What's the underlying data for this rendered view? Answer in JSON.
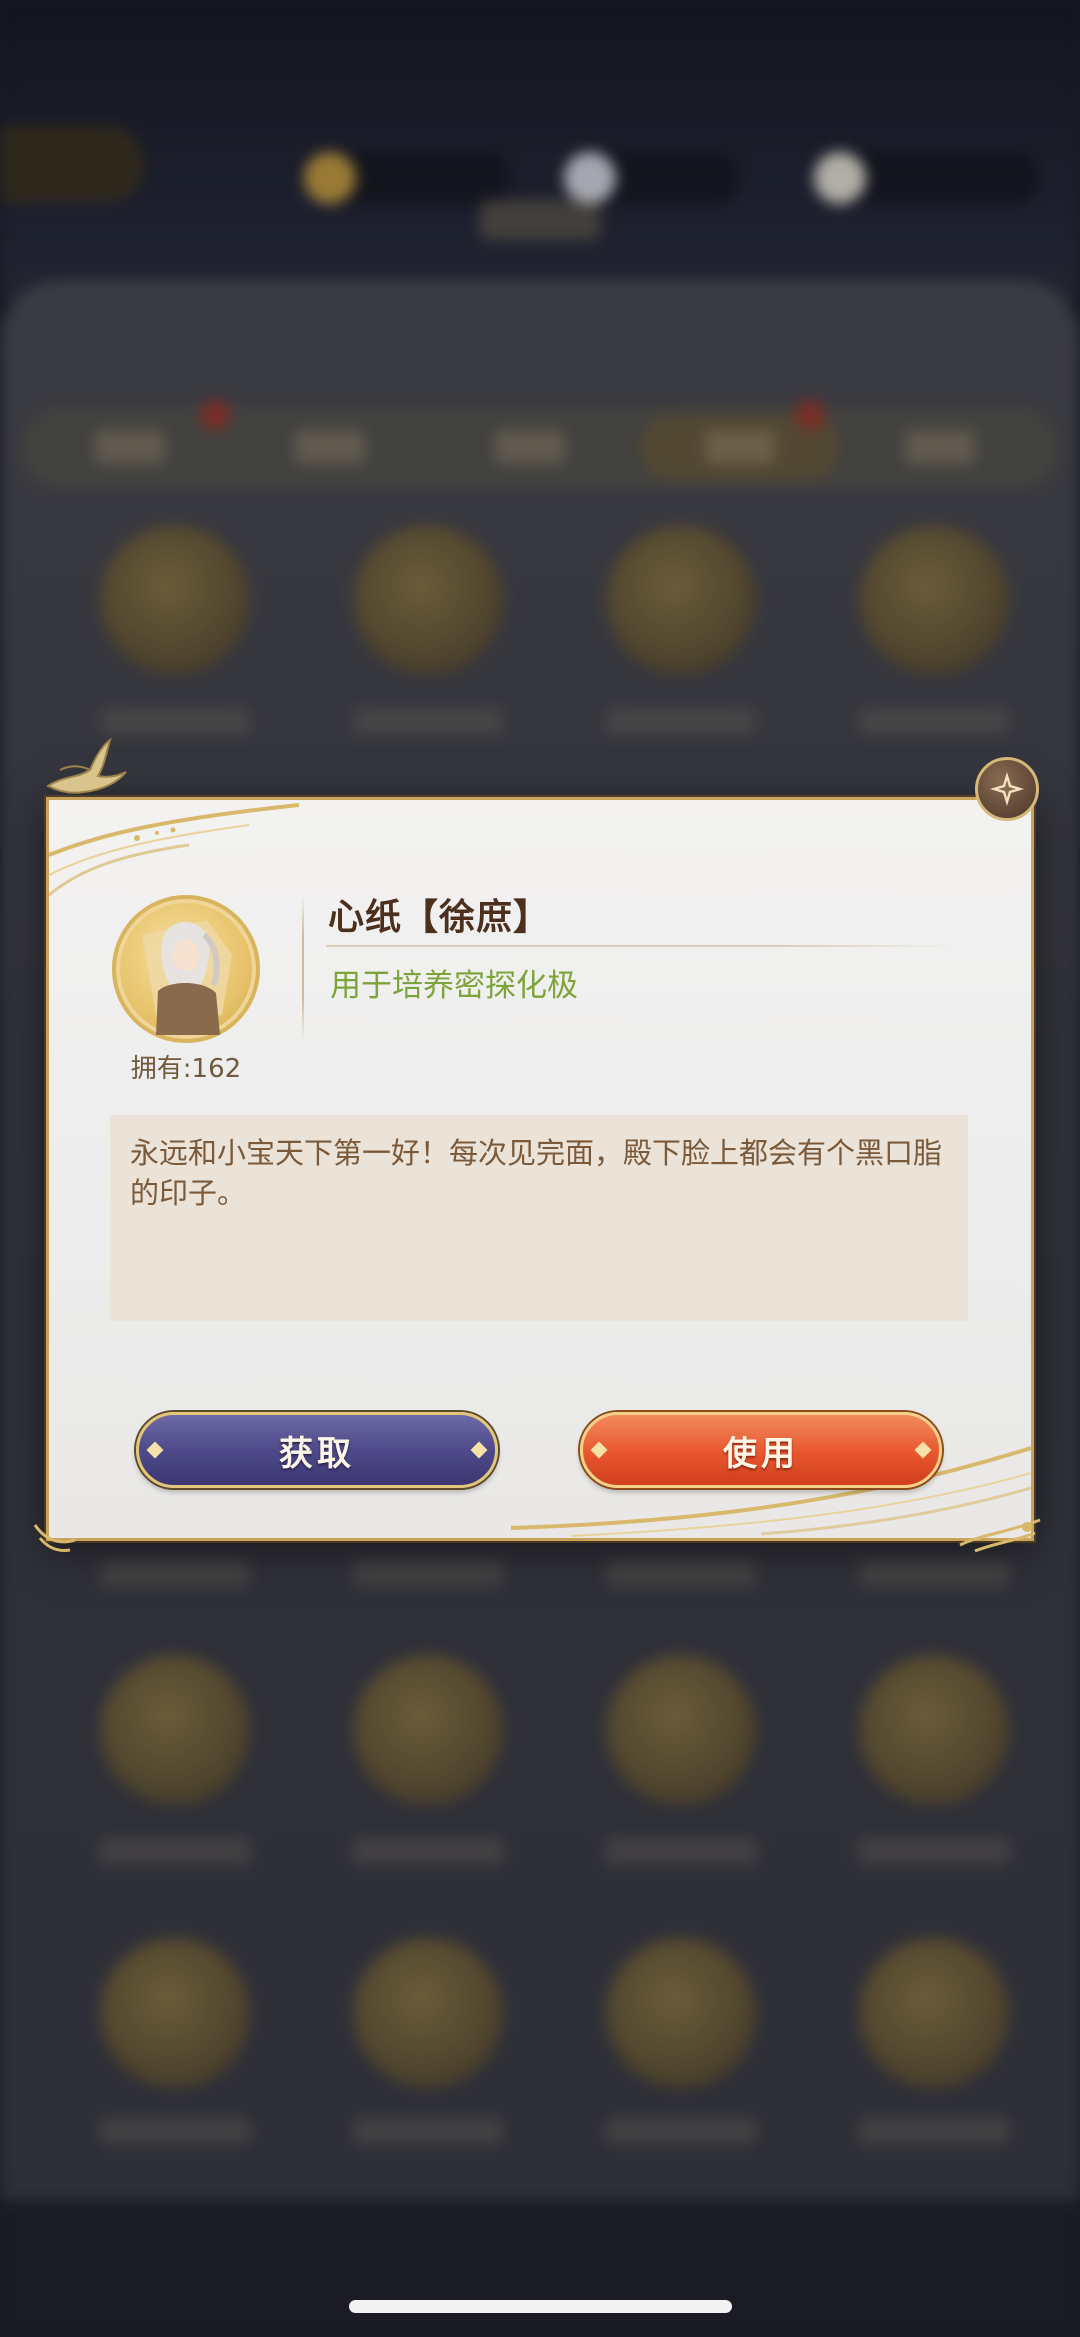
{
  "dialog": {
    "item_name": "心纸【徐庶】",
    "item_usage": "用于培养密探化极",
    "owned_label": "拥有:162",
    "description": "永远和小宝天下第一好！每次见完面，殿下脸上都会有个黑口脂的印子。",
    "acquire_label": "获取",
    "use_label": "使用"
  },
  "colors": {
    "dialog_border": "#c9a35a",
    "usage_text": "#7da43a",
    "acquire_button": "#4f4a8a",
    "use_button": "#e8562f"
  }
}
